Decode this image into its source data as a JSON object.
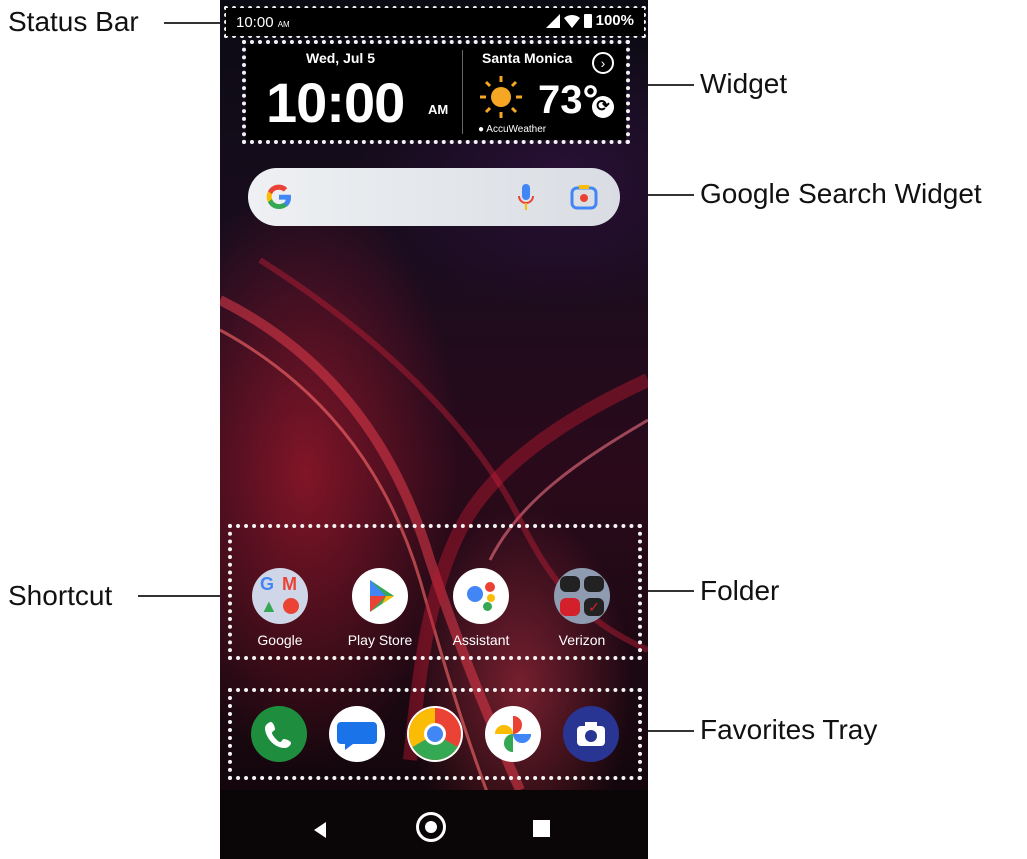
{
  "callouts": {
    "status_bar": "Status Bar",
    "widget": "Widget",
    "google_search_widget": "Google Search Widget",
    "shortcut": "Shortcut",
    "folder": "Folder",
    "favorites_tray": "Favorites Tray"
  },
  "status_bar": {
    "time": "10:00",
    "ampm": "AM",
    "battery": "100%"
  },
  "widget": {
    "date": "Wed, Jul 5",
    "time": "10:00",
    "ampm": "AM",
    "city": "Santa Monica",
    "temperature": "73°",
    "provider": "AccuWeather"
  },
  "shortcuts": [
    {
      "label": "Google",
      "icon": "google-folder-icon"
    },
    {
      "label": "Play Store",
      "icon": "play-store-icon"
    },
    {
      "label": "Assistant",
      "icon": "assistant-icon"
    },
    {
      "label": "Verizon",
      "icon": "verizon-folder-icon"
    }
  ],
  "favorites_tray": [
    {
      "icon": "phone-icon"
    },
    {
      "icon": "messages-icon"
    },
    {
      "icon": "chrome-icon"
    },
    {
      "icon": "photos-icon"
    },
    {
      "icon": "camera-icon"
    }
  ],
  "colors": {
    "phone_green": "#1e8e3e",
    "camera_blue": "#283593",
    "wallpaper_red": "#c8102e"
  }
}
